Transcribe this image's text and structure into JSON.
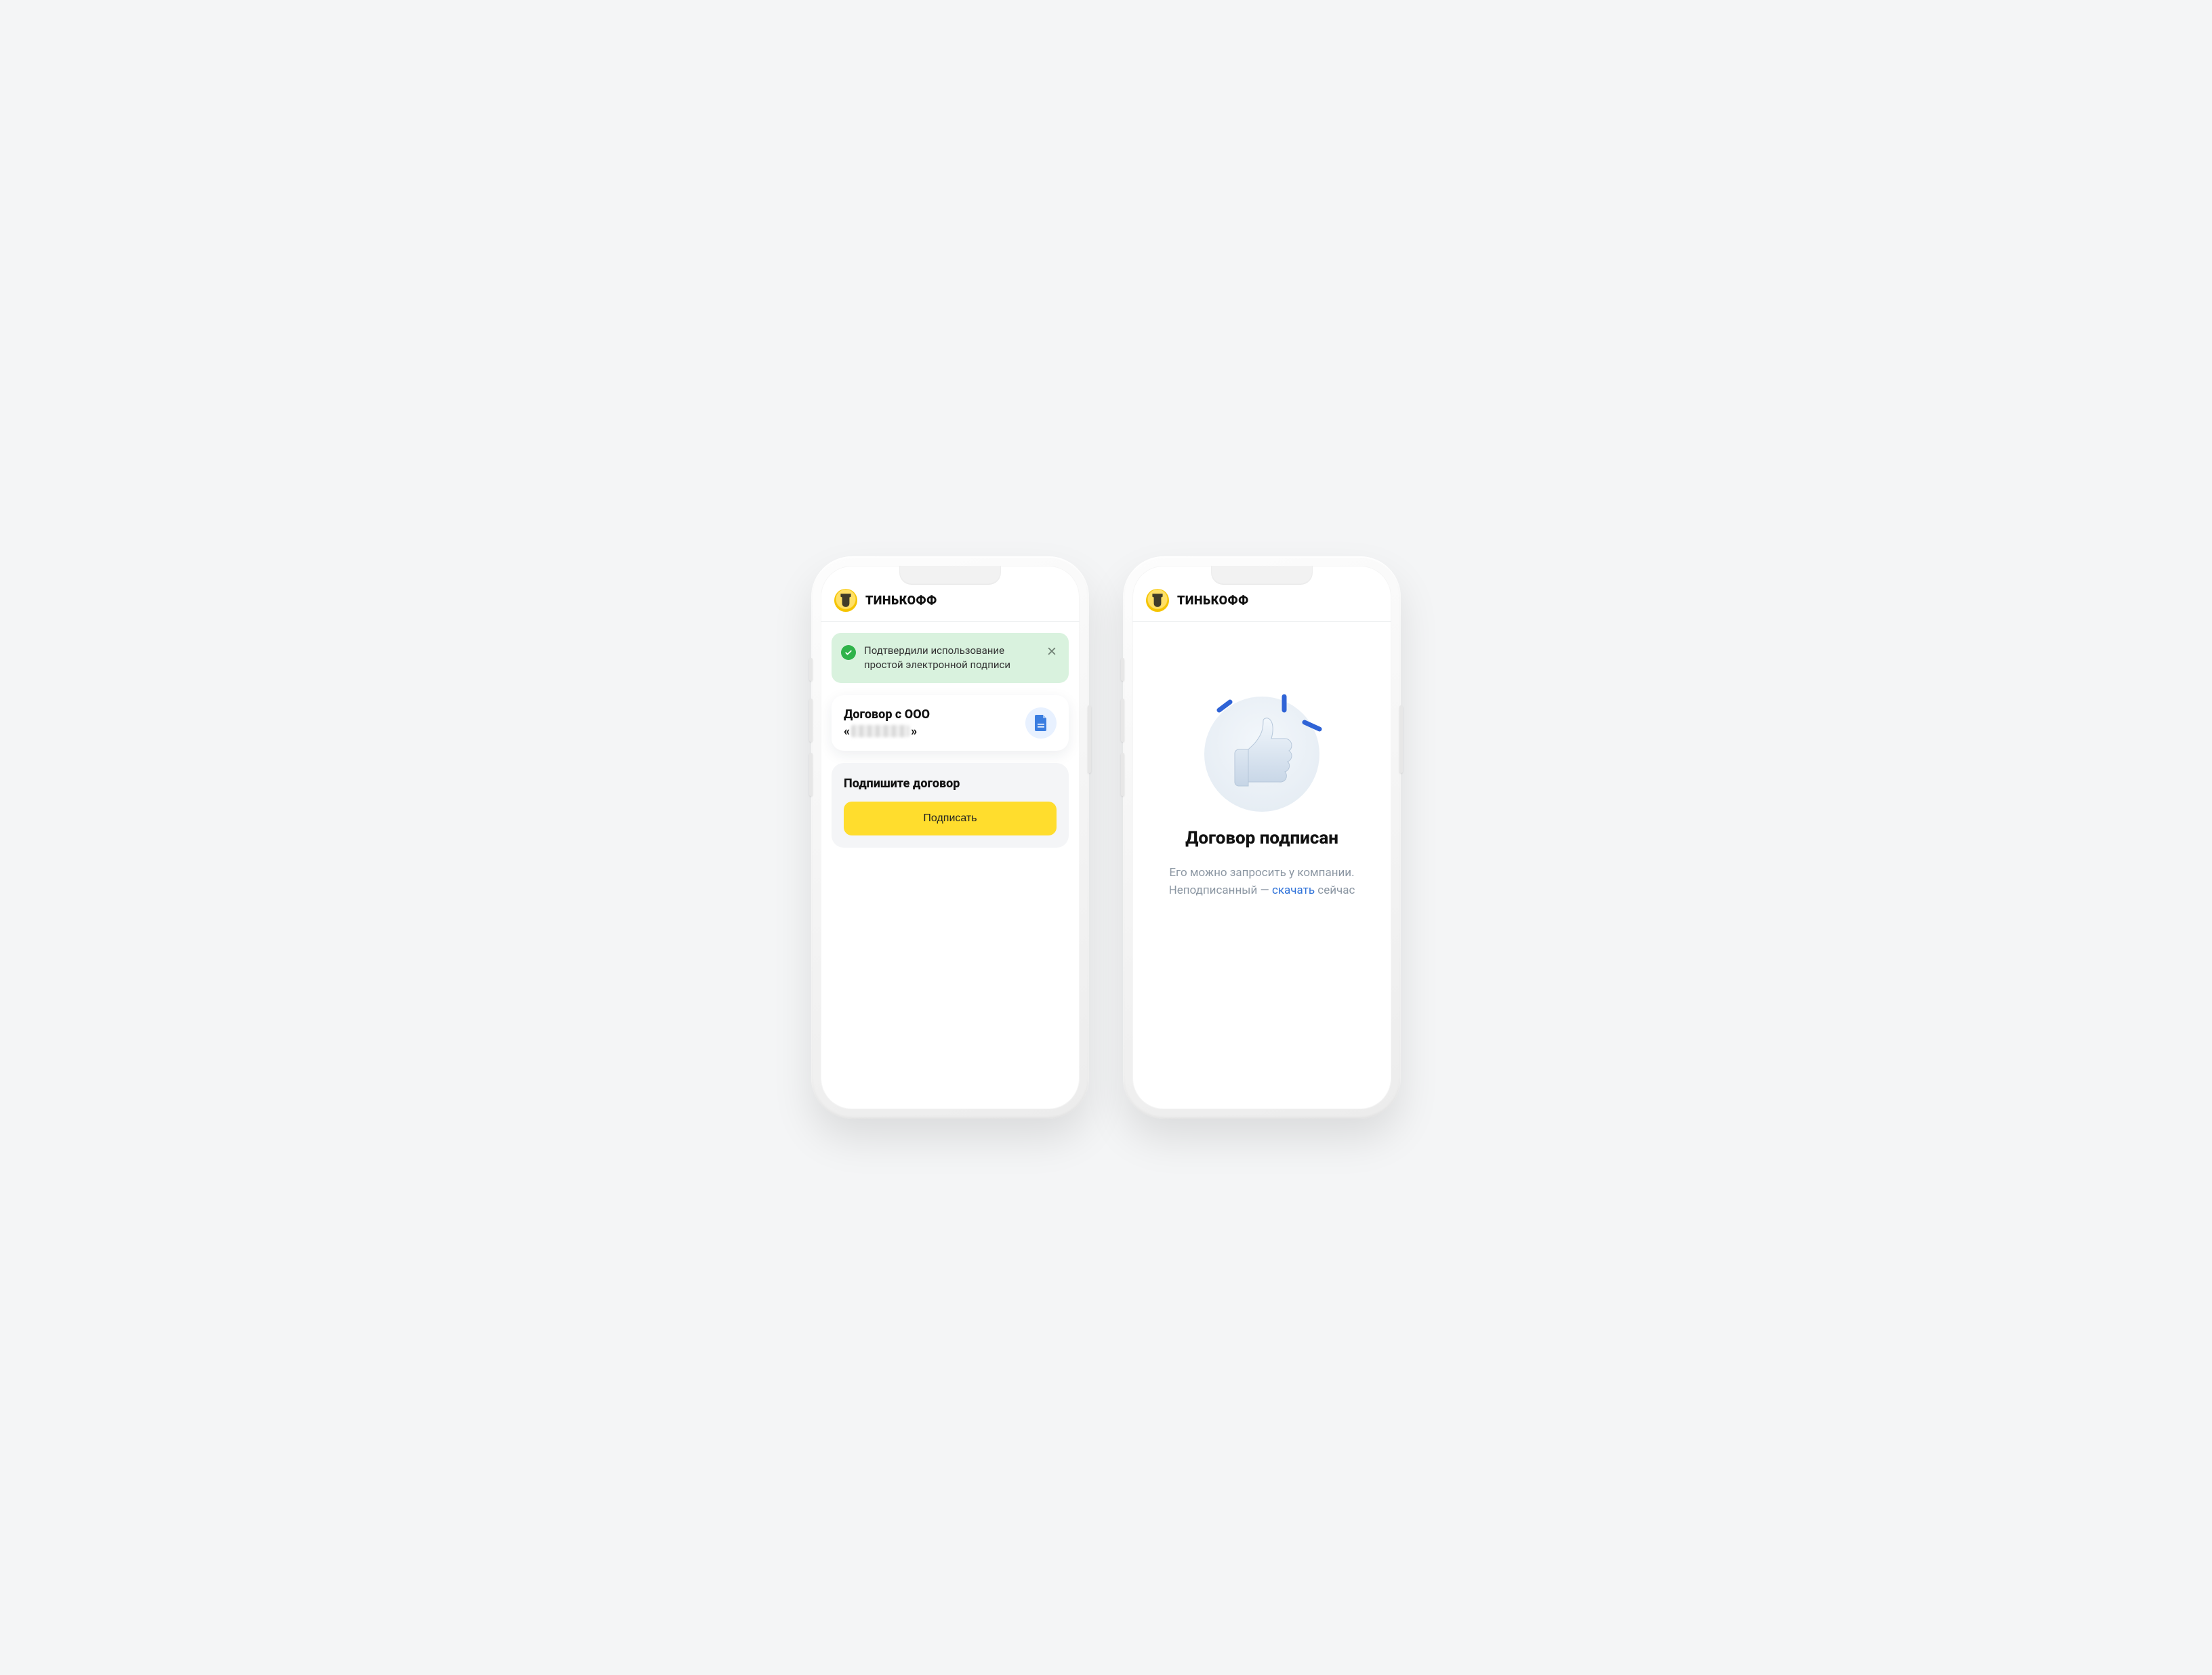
{
  "brand": "ТИНЬКОФФ",
  "left": {
    "toast": {
      "text": "Подтвердили использование простой электронной подписи"
    },
    "document": {
      "line1": "Договор с ООО",
      "quote_open": "«",
      "quote_close": "»"
    },
    "sign": {
      "title": "Подпишите договор",
      "button": "Подписать"
    }
  },
  "right": {
    "title": "Договор подписан",
    "line1": "Его можно запросить у компании.",
    "line2_prefix": "Неподписанный — ",
    "link": "скачать",
    "line2_suffix": " сейчас"
  }
}
